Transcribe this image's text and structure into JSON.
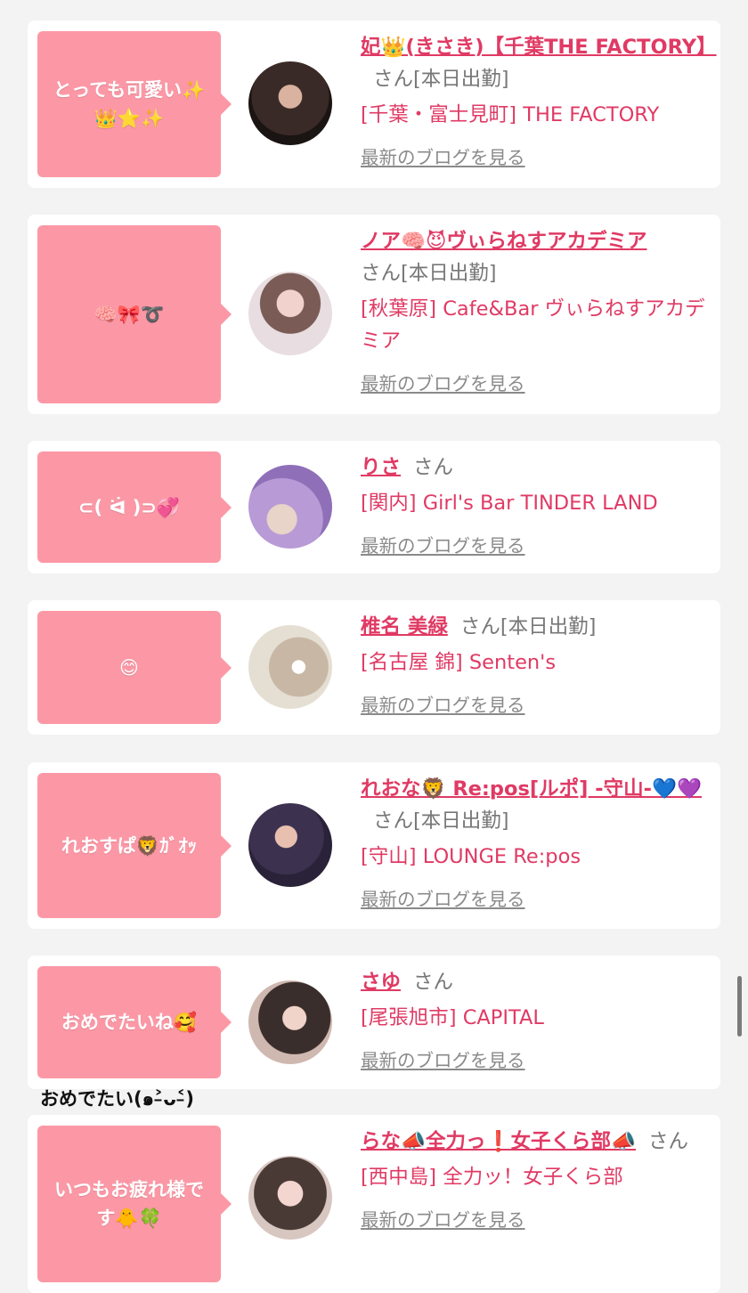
{
  "items": [
    {
      "message": "とっても可愛い✨👑⭐✨",
      "name": "妃👑(きさき)【千葉THE FACTORY】",
      "san": "さん",
      "today": "[本日出勤]",
      "shop": "[千葉・富士見町] THE FACTORY",
      "blog_link": "最新のブログを見る"
    },
    {
      "message": "🧠🎀➰",
      "name": "ノア🧠😈ヴぃらねすアカデミア",
      "san": "さん",
      "today": "[本日出勤]",
      "shop": "[秋葉原] Cafe&Bar ヴぃらねすアカデミア",
      "blog_link": "最新のブログを見る"
    },
    {
      "message": "⊂( ᐛ )⊃💞",
      "name": "りさ",
      "san": "さん",
      "today": "",
      "shop": "[関内] Girl's Bar TINDER LAND",
      "blog_link": "最新のブログを見る"
    },
    {
      "message": "😊",
      "name": "椎名 美緑",
      "san": "さん",
      "today": "[本日出勤]",
      "shop": "[名古屋 錦] Senten's",
      "blog_link": "最新のブログを見る"
    },
    {
      "message": "れおすぱ🦁ｶﾞｵｯ",
      "name": "れおな🦁 Re:pos[ルポ] -守山-💙💜",
      "san": "さん",
      "today": "[本日出勤]",
      "shop": "[守山] LOUNGE Re:pos",
      "blog_link": "最新のブログを見る"
    },
    {
      "message": "おめでたいね🥰",
      "name": "さゆ",
      "san": "さん",
      "today": "",
      "shop": "[尾張旭市] CAPITAL",
      "blog_link": "最新のブログを見る"
    },
    {
      "message": "いつもお疲れ様です🐥🍀",
      "name": "らな📣全力っ❗女子くら部📣",
      "san": "さん",
      "today": "",
      "shop": "[西中島] 全力ッ！女子くら部",
      "blog_link": "最新のブログを見る"
    }
  ],
  "between_text": "おめでたい(๑˃̵ᴗ˂̵)",
  "colors": {
    "bubble": "#fc98a6",
    "name": "#e03a64",
    "background": "#f3f3f3"
  }
}
